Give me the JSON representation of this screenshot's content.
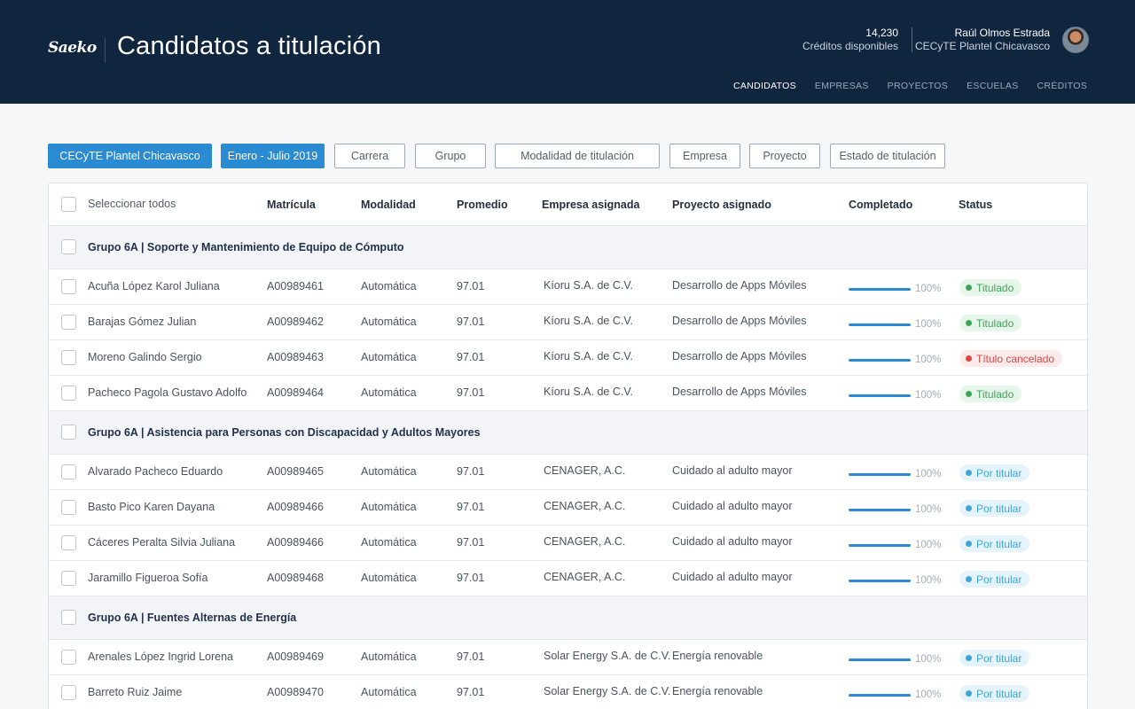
{
  "header": {
    "logo": "Saeko",
    "title": "Candidatos a titulación",
    "credits_value": "14,230",
    "credits_label": "Créditos disponibles",
    "user_name": "Raúl Olmos Estrada",
    "user_school": "CECyTE Plantel Chicavasco",
    "nav": [
      "CANDIDATOS",
      "EMPRESAS",
      "PROYECTOS",
      "ESCUELAS",
      "CRÉDITOS"
    ]
  },
  "filters": [
    "CECyTE Plantel Chicavasco",
    "Enero - Julio 2019",
    "Carrera",
    "Grupo",
    "Modalidad de titulación",
    "Empresa",
    "Proyecto",
    "Estado de titulación"
  ],
  "table": {
    "headers": {
      "select_all": "Seleccionar todos",
      "matricula": "Matrícula",
      "modalidad": "Modalidad",
      "promedio": "Promedio",
      "empresa": "Empresa asignada",
      "proyecto": "Proyecto asignado",
      "completado": "Completado",
      "status": "Status"
    },
    "groups": [
      {
        "title": "Grupo 6A | Soporte y Mantenimiento de Equipo de Cómputo",
        "rows": [
          {
            "name": "Acuña López Karol Juliana",
            "matricula": "A00989461",
            "modalidad": "Automática",
            "promedio": "97.01",
            "empresa": "Kíoru S.A. de C.V.",
            "proyecto": "Desarrollo de Apps Móviles",
            "completado": "100%",
            "status": "Titulado"
          },
          {
            "name": "Barajas Gómez Julian",
            "matricula": "A00989462",
            "modalidad": "Automática",
            "promedio": "97.01",
            "empresa": "Kíoru S.A. de C.V.",
            "proyecto": "Desarrollo de Apps Móviles",
            "completado": "100%",
            "status": "Titulado"
          },
          {
            "name": "Moreno Galindo Sergio",
            "matricula": "A00989463",
            "modalidad": "Automática",
            "promedio": "97.01",
            "empresa": "Kíoru S.A. de C.V.",
            "proyecto": "Desarrollo de Apps Móviles",
            "completado": "100%",
            "status": "Título cancelado"
          },
          {
            "name": "Pacheco Pagola Gustavo Adolfo",
            "matricula": "A00989464",
            "modalidad": "Automática",
            "promedio": "97.01",
            "empresa": "Kíoru S.A. de C.V.",
            "proyecto": "Desarrollo de Apps Móviles",
            "completado": "100%",
            "status": "Titulado"
          }
        ]
      },
      {
        "title": "Grupo 6A | Asistencia para Personas con Discapacidad y Adultos Mayores",
        "rows": [
          {
            "name": "Alvarado Pacheco Eduardo",
            "matricula": "A00989465",
            "modalidad": "Automática",
            "promedio": "97.01",
            "empresa": "CENAGER, A.C.",
            "proyecto": "Cuidado al adulto mayor",
            "completado": "100%",
            "status": "Por titular"
          },
          {
            "name": "Basto Pico Karen Dayana",
            "matricula": "A00989466",
            "modalidad": "Automática",
            "promedio": "97.01",
            "empresa": "CENAGER, A.C.",
            "proyecto": "Cuidado al adulto mayor",
            "completado": "100%",
            "status": "Por titular"
          },
          {
            "name": "Cáceres Peralta Silvia Juliana",
            "matricula": "A00989466",
            "modalidad": "Automática",
            "promedio": "97.01",
            "empresa": "CENAGER, A.C.",
            "proyecto": "Cuidado al adulto mayor",
            "completado": "100%",
            "status": "Por titular"
          },
          {
            "name": "Jaramillo Figueroa Sofía",
            "matricula": "A00989468",
            "modalidad": "Automática",
            "promedio": "97.01",
            "empresa": "CENAGER, A.C.",
            "proyecto": "Cuidado al adulto mayor",
            "completado": "100%",
            "status": "Por titular"
          }
        ]
      },
      {
        "title": "Grupo 6A | Fuentes Alternas de Energía",
        "rows": [
          {
            "name": "Arenales López Ingrid Lorena",
            "matricula": "A00989469",
            "modalidad": "Automática",
            "promedio": "97.01",
            "empresa": "Solar Energy S.A. de C.V.",
            "proyecto": "Energía renovable",
            "completado": "100%",
            "status": "Por titular"
          },
          {
            "name": "Barreto Ruiz Jaime",
            "matricula": "A00989470",
            "modalidad": "Automática",
            "promedio": "97.01",
            "empresa": "Solar Energy S.A. de C.V.",
            "proyecto": "Energía renovable",
            "completado": "100%",
            "status": "Por titular"
          }
        ]
      }
    ]
  },
  "status_colors": {
    "Titulado": "#3da55a",
    "Título cancelado": "#e04444",
    "Por titular": "#3fa5d8"
  }
}
